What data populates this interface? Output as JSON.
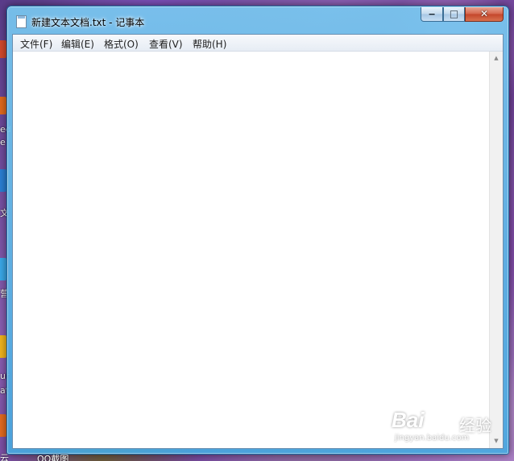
{
  "window": {
    "title": "新建文本文档.txt - 记事本",
    "minimize_glyph": "‒",
    "maximize_glyph": "□",
    "close_glyph": "✕"
  },
  "menu": {
    "items": [
      {
        "label": "文件(F)"
      },
      {
        "label": "编辑(E)"
      },
      {
        "label": "格式(O)"
      },
      {
        "label": "查看(V)"
      },
      {
        "label": "帮助(H)"
      }
    ]
  },
  "editor": {
    "content": ""
  },
  "scrollbar": {
    "up_arrow": "▲",
    "down_arrow": "▼"
  },
  "desktop": {
    "edge_texts": [
      "ed",
      "e",
      "文",
      "营",
      "ur",
      "at",
      "云"
    ],
    "taskbar_label": "QQ截图"
  },
  "watermark": {
    "logo": "Bai",
    "logo_suffix": "经验",
    "url": "jingyan.baidu.com"
  },
  "colors": {
    "aero_frame": "#58b4e6",
    "close_button": "#c8452a",
    "menu_bg": "#eef2f7"
  },
  "icons": {
    "title_icon": "notepad-icon",
    "paw_icon": "baidu-paw-icon"
  }
}
